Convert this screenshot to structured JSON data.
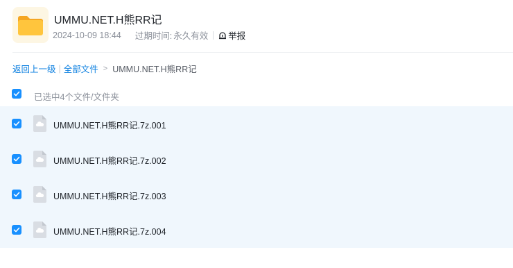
{
  "share": {
    "title": "UMMU.NET.H熊RR记",
    "date": "2024-10-09 18:44",
    "expiry_label": "过期时间:",
    "expiry_value": "永久有效",
    "report_label": "举报",
    "icon": "folder-icon"
  },
  "breadcrumb": {
    "back": "返回上一级",
    "all_files": "全部文件",
    "arrow": ">",
    "current": "UMMU.NET.H熊RR记"
  },
  "selection": {
    "summary": "已选中4个文件/文件夹",
    "all_checked": true
  },
  "files": [
    {
      "name": "UMMU.NET.H熊RR记.7z.001",
      "checked": true,
      "icon": "cloud-file-icon"
    },
    {
      "name": "UMMU.NET.H熊RR记.7z.002",
      "checked": true,
      "icon": "cloud-file-icon"
    },
    {
      "name": "UMMU.NET.H熊RR记.7z.003",
      "checked": true,
      "icon": "cloud-file-icon"
    },
    {
      "name": "UMMU.NET.H熊RR记.7z.004",
      "checked": true,
      "icon": "cloud-file-icon"
    }
  ],
  "colors": {
    "accent": "#1890ff",
    "link": "#0b7fe0",
    "selected_row_bg": "#f0f7fd",
    "folder": "#ffc53d"
  }
}
